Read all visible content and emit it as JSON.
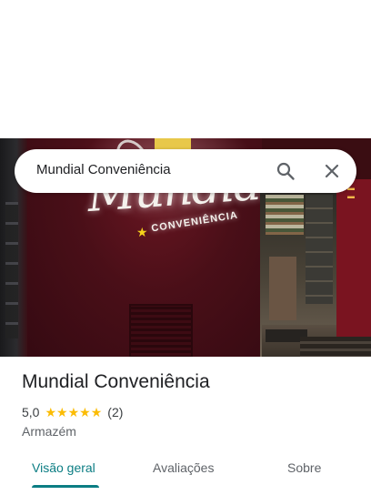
{
  "search": {
    "query": "Mundial Conveniência"
  },
  "hero": {
    "sign_script": "Mundial",
    "sign_subtitle": "CONVENIÊNCIA"
  },
  "place": {
    "name": "Mundial Conveniência",
    "rating": "5,0",
    "stars": 5,
    "review_count": "(2)",
    "category": "Armazém"
  },
  "tabs": [
    {
      "label": "Visão geral",
      "active": true
    },
    {
      "label": "Avaliações",
      "active": false
    },
    {
      "label": "Sobre",
      "active": false
    }
  ],
  "colors": {
    "accent": "#0b7d83",
    "star": "#fbbc04"
  }
}
